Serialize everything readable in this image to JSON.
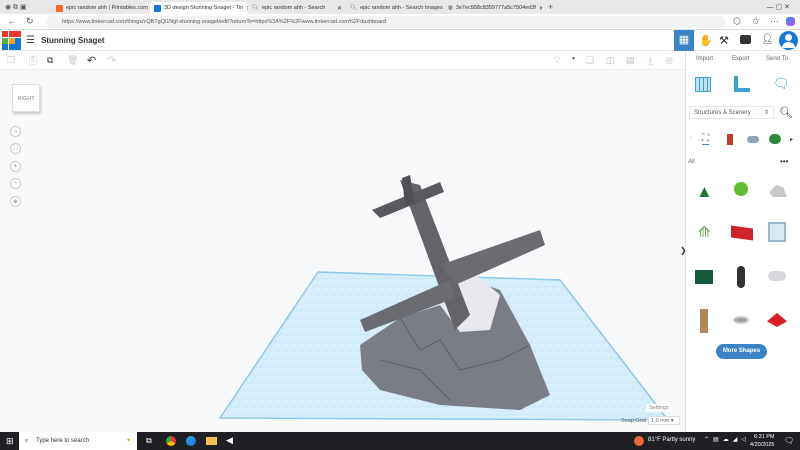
{
  "browser": {
    "tabs": [
      {
        "label": "epic random ahh | Printables.com",
        "color": "#fa6831"
      },
      {
        "label": "3D design Stunning Snaget - Tin",
        "color": "#1477d4",
        "active": true
      },
      {
        "label": "epic random ahh - Search",
        "color": "#3b83c4"
      },
      {
        "label": "epic random ahh - Search Images",
        "color": "#3b83c4"
      },
      {
        "label": "3e7ec958c8359777a5c7504ed3f",
        "color": "#666"
      }
    ],
    "url": "https://www.tinkercad.com/things/cQBTgQl1Ngl-stunning-snaget/edit?returnTo=https%3A%2F%2Fwww.tinkercad.com%2Fdashboard"
  },
  "app": {
    "logo": "TINKERCAD",
    "title": "Stunning Snaget",
    "actions": {
      "import": "Import",
      "export": "Export",
      "send_to": "Send To"
    }
  },
  "viewcube": {
    "face": "RIGHT"
  },
  "panel": {
    "category": "Structures & Scenery",
    "filter": "All",
    "more_shapes": "More Shapes"
  },
  "footer": {
    "settings": "Settings",
    "snap_label": "Snap Grid",
    "snap_value": "1.0 mm"
  },
  "taskbar": {
    "search_placeholder": "Type here to search",
    "weather": "81°F  Partly sunny",
    "time": "6:31 PM",
    "date": "4/20/2025"
  }
}
